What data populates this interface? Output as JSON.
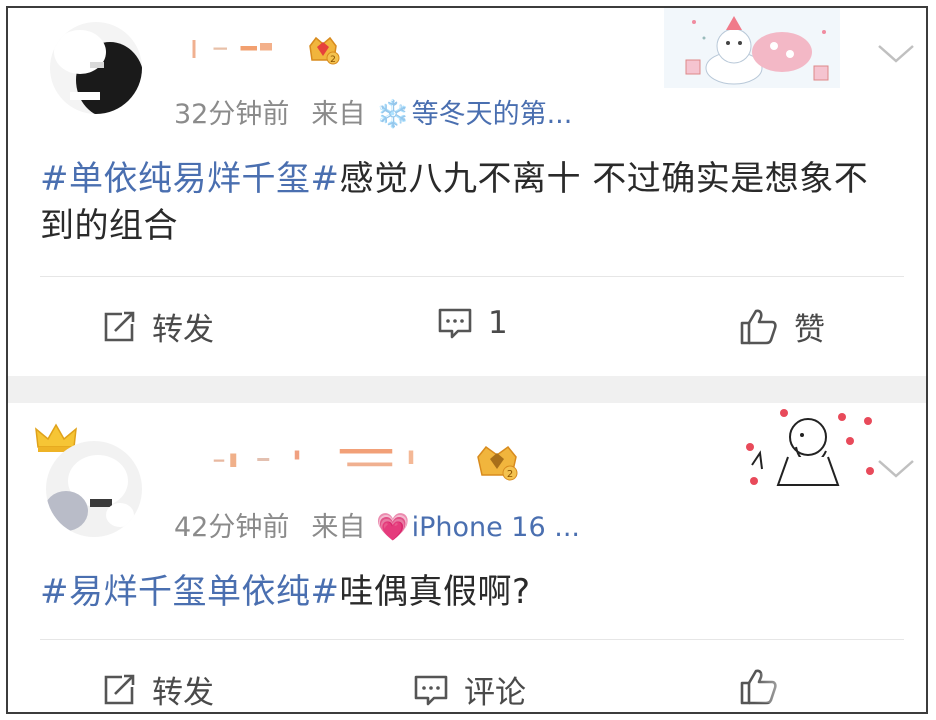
{
  "posts": [
    {
      "time": "32分钟前",
      "from_label": "来自",
      "source_emoji": "❄️",
      "source": "等冬天的第...",
      "hashtag": "#单依纯易烊千玺#",
      "body": "感觉八九不离十 不过确实是想象不到的组合",
      "actions": {
        "repost": "转发",
        "comment": "1",
        "like": "赞"
      }
    },
    {
      "time": "42分钟前",
      "from_label": "来自",
      "source_emoji": "💗",
      "source": "iPhone 16 ...",
      "hashtag": "#易烊千玺单依纯#",
      "body": "哇偶真假啊?",
      "actions": {
        "repost": "转发",
        "comment": "评论"
      }
    }
  ],
  "colors": {
    "hashtag": "#4a6fb0",
    "meta": "#8b8b8b",
    "text": "#2a2a2a"
  },
  "icons": [
    "repost-icon",
    "comment-icon",
    "like-icon",
    "chevron-down-icon",
    "crown-badge-icon"
  ]
}
